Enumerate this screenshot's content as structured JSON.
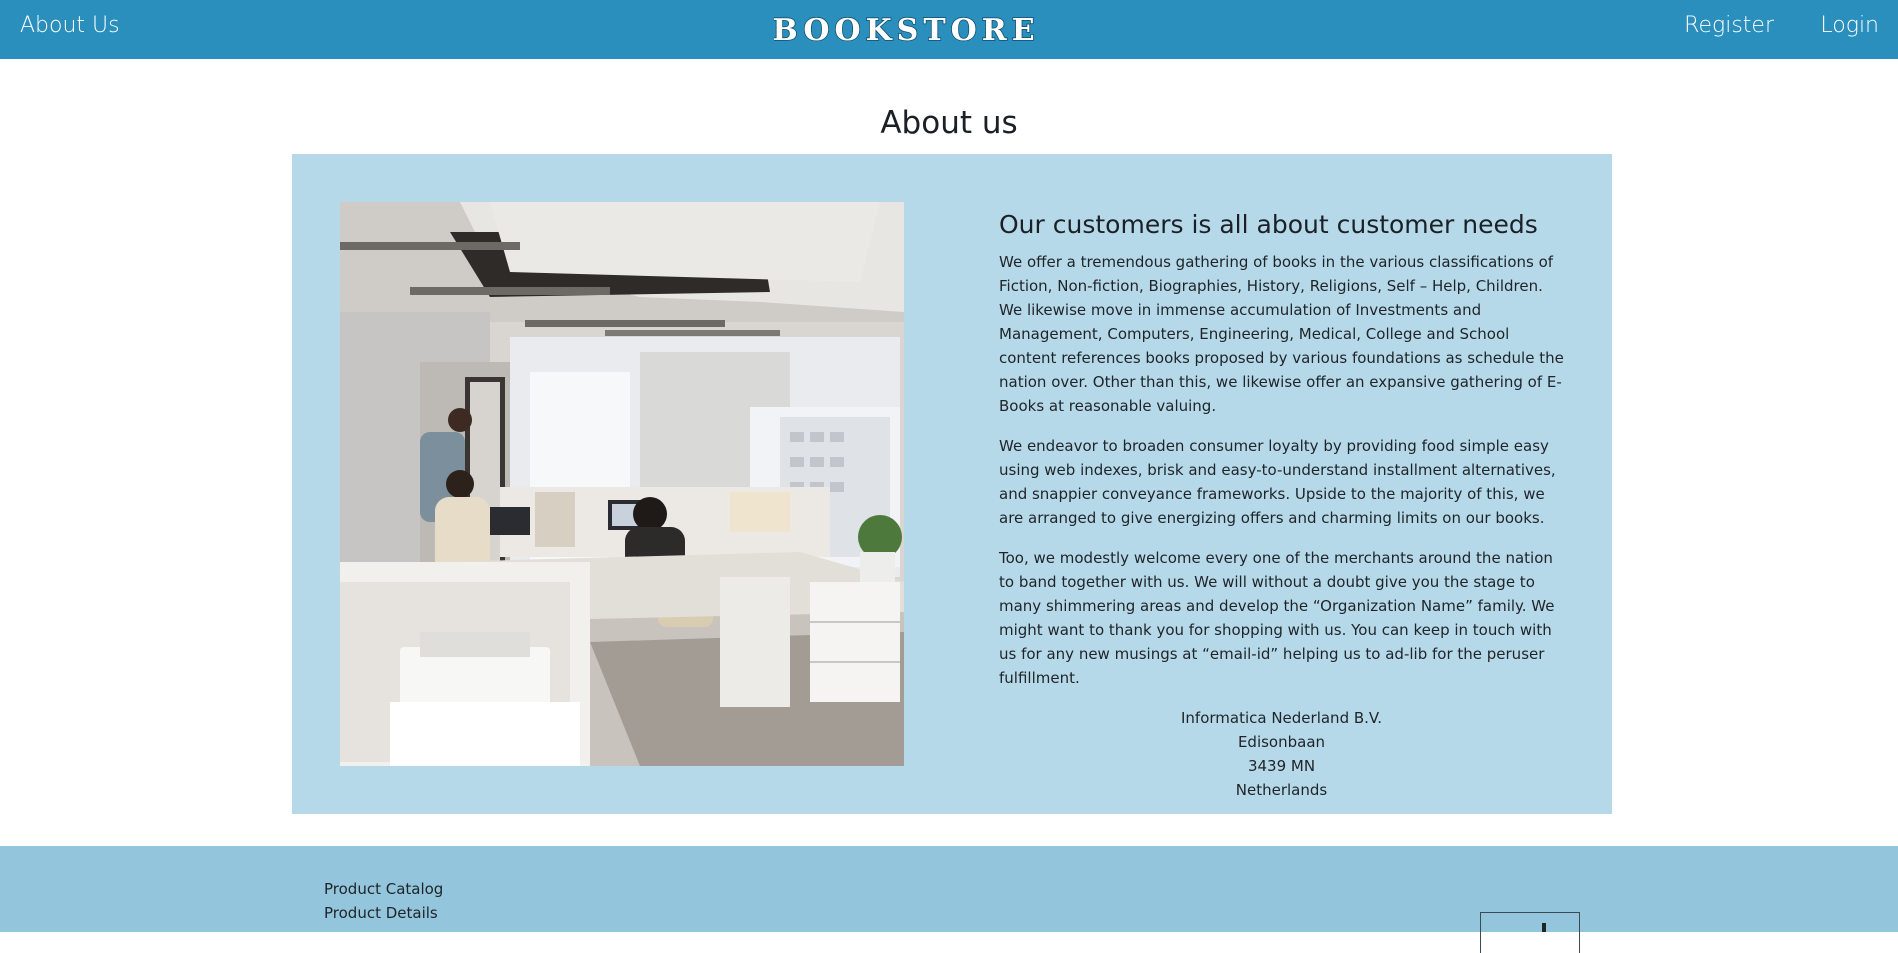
{
  "header": {
    "about_label": "About Us",
    "logo_text": "BOOKSTORE",
    "register_label": "Register",
    "login_label": "Login"
  },
  "main": {
    "title": "About us",
    "heading": "Our customers is all about customer needs",
    "paragraphs": [
      "We offer a tremendous gathering of books in the various classifications of Fiction, Non-fiction, Biographies, History, Religions, Self – Help, Children. We likewise move in immense accumulation of Investments and Management, Computers, Engineering, Medical, College and School content references books proposed by various foundations as schedule the nation over. Other than this, we likewise offer an expansive gathering of E-Books at reasonable valuing.",
      "We endeavor to broaden consumer loyalty by providing food simple easy using web indexes, brisk and easy-to-understand installment alternatives, and snappier conveyance frameworks. Upside to the majority of this, we are arranged to give energizing offers and charming limits on our books.",
      "Too, we modestly welcome every one of the merchants around the nation to band together with us. We will without a doubt give you the stage to many shimmering areas and develop the “Organization Name” family. We might want to thank you for shopping with us. You can keep in touch with us for any new musings at “email-id” helping us to ad-lib for the peruser fulfillment."
    ],
    "address": [
      "Informatica Nederland B.V.",
      "Edisonbaan",
      "3439 MN",
      "Netherlands"
    ]
  },
  "footer": {
    "links": [
      "Product Catalog",
      "Product Details"
    ]
  },
  "colors": {
    "header_bg": "#2b8fbe",
    "panel_bg": "#b6d9ea",
    "footer_bg": "#93c5dc"
  }
}
